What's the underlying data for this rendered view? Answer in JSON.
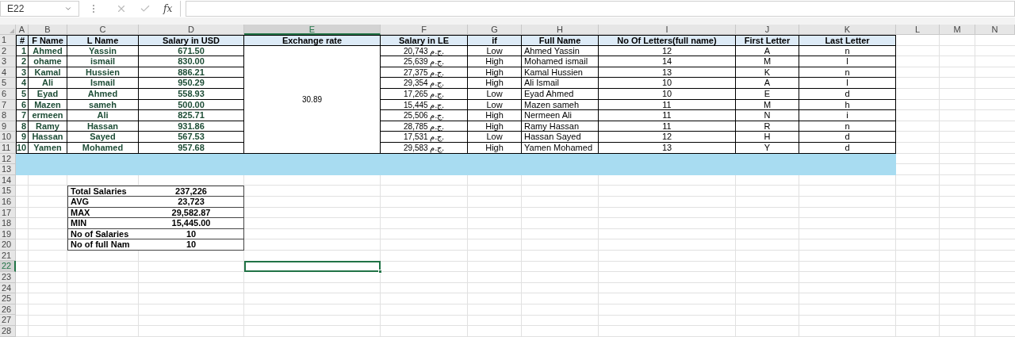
{
  "formula_bar": {
    "name_box": "E22",
    "function_label": "fx"
  },
  "column_headers": [
    {
      "label": "A",
      "selected": false
    },
    {
      "label": "B",
      "selected": false
    },
    {
      "label": "C",
      "selected": false
    },
    {
      "label": "D",
      "selected": false
    },
    {
      "label": "E",
      "selected": true
    },
    {
      "label": "F",
      "selected": false
    },
    {
      "label": "G",
      "selected": false
    },
    {
      "label": "H",
      "selected": false
    },
    {
      "label": "I",
      "selected": false
    },
    {
      "label": "J",
      "selected": false
    },
    {
      "label": "K",
      "selected": false
    },
    {
      "label": "L",
      "selected": false
    },
    {
      "label": "M",
      "selected": false
    },
    {
      "label": "N",
      "selected": false
    }
  ],
  "row_numbers": [
    {
      "label": "1",
      "selected": false
    },
    {
      "label": "2",
      "selected": false
    },
    {
      "label": "3",
      "selected": false
    },
    {
      "label": "4",
      "selected": false
    },
    {
      "label": "5",
      "selected": false
    },
    {
      "label": "6",
      "selected": false
    },
    {
      "label": "7",
      "selected": false
    },
    {
      "label": "8",
      "selected": false
    },
    {
      "label": "9",
      "selected": false
    },
    {
      "label": "10",
      "selected": false
    },
    {
      "label": "11",
      "selected": false
    },
    {
      "label": "12",
      "selected": false
    },
    {
      "label": "13",
      "selected": false
    },
    {
      "label": "14",
      "selected": false
    },
    {
      "label": "15",
      "selected": false
    },
    {
      "label": "16",
      "selected": false
    },
    {
      "label": "17",
      "selected": false
    },
    {
      "label": "18",
      "selected": false
    },
    {
      "label": "19",
      "selected": false
    },
    {
      "label": "20",
      "selected": false
    },
    {
      "label": "21",
      "selected": false
    },
    {
      "label": "22",
      "selected": true
    },
    {
      "label": "23",
      "selected": false
    },
    {
      "label": "24",
      "selected": false
    },
    {
      "label": "25",
      "selected": false
    },
    {
      "label": "26",
      "selected": false
    },
    {
      "label": "27",
      "selected": false
    },
    {
      "label": "28",
      "selected": false
    }
  ],
  "table": {
    "columns": [
      "#",
      "F Name",
      "L Name",
      "Salary in USD",
      "Exchange rate",
      "Salary in LE",
      "if",
      "Full Name",
      "No Of Letters(full name)",
      "First Letter",
      "Last Letter"
    ],
    "exchange_rate": "30.89",
    "rows": [
      {
        "num": "1",
        "first_name": "Ahmed",
        "last_name": "Yassin",
        "salary_usd": "671.50",
        "salary_le": "20,743 ج.م.",
        "level": "Low",
        "full_name": "Ahmed Yassin",
        "letters": "12",
        "first_letter": "A",
        "last_letter": "n"
      },
      {
        "num": "2",
        "first_name": "ohame",
        "last_name": "ismail",
        "salary_usd": "830.00",
        "salary_le": "25,639 ج.م.",
        "level": "High",
        "full_name": "Mohamed ismail",
        "letters": "14",
        "first_letter": "M",
        "last_letter": "l"
      },
      {
        "num": "3",
        "first_name": "Kamal",
        "last_name": "Hussien",
        "salary_usd": "886.21",
        "salary_le": "27,375 ج.م.",
        "level": "High",
        "full_name": "Kamal Hussien",
        "letters": "13",
        "first_letter": "K",
        "last_letter": "n"
      },
      {
        "num": "4",
        "first_name": "Ali",
        "last_name": "Ismail",
        "salary_usd": "950.29",
        "salary_le": "29,354 ج.م.",
        "level": "High",
        "full_name": "Ali Ismail",
        "letters": "10",
        "first_letter": "A",
        "last_letter": "l"
      },
      {
        "num": "5",
        "first_name": "Eyad",
        "last_name": "Ahmed",
        "salary_usd": "558.93",
        "salary_le": "17,265 ج.م.",
        "level": "Low",
        "full_name": "Eyad Ahmed",
        "letters": "10",
        "first_letter": "E",
        "last_letter": "d"
      },
      {
        "num": "6",
        "first_name": "Mazen",
        "last_name": "sameh",
        "salary_usd": "500.00",
        "salary_le": "15,445 ج.م.",
        "level": "Low",
        "full_name": "Mazen sameh",
        "letters": "11",
        "first_letter": "M",
        "last_letter": "h"
      },
      {
        "num": "7",
        "first_name": "ermeen",
        "last_name": "Ali",
        "salary_usd": "825.71",
        "salary_le": "25,506 ج.م.",
        "level": "High",
        "full_name": "Nermeen Ali",
        "letters": "11",
        "first_letter": "N",
        "last_letter": "i"
      },
      {
        "num": "8",
        "first_name": "Ramy",
        "last_name": "Hassan",
        "salary_usd": "931.86",
        "salary_le": "28,785 ج.م.",
        "level": "High",
        "full_name": "Ramy Hassan",
        "letters": "11",
        "first_letter": "R",
        "last_letter": "n"
      },
      {
        "num": "9",
        "first_name": "Hassan",
        "last_name": "Sayed",
        "salary_usd": "567.53",
        "salary_le": "17,531 ج.م.",
        "level": "Low",
        "full_name": "Hassan Sayed",
        "letters": "12",
        "first_letter": "H",
        "last_letter": "d"
      },
      {
        "num": "10",
        "first_name": "Yamen",
        "last_name": "Mohamed",
        "salary_usd": "957.68",
        "salary_le": "29,583 ج.م.",
        "level": "High",
        "full_name": "Yamen Mohamed",
        "letters": "13",
        "first_letter": "Y",
        "last_letter": "d"
      }
    ]
  },
  "summary": [
    {
      "label": "Total  Salaries",
      "value": "237,226"
    },
    {
      "label": "AVG",
      "value": "23,723"
    },
    {
      "label": "MAX",
      "value": "29,582.87"
    },
    {
      "label": "MIN",
      "value": "15,445.00"
    },
    {
      "label": "No of Salaries",
      "value": "10"
    },
    {
      "label": "No of full Nam",
      "value": "10"
    }
  ]
}
